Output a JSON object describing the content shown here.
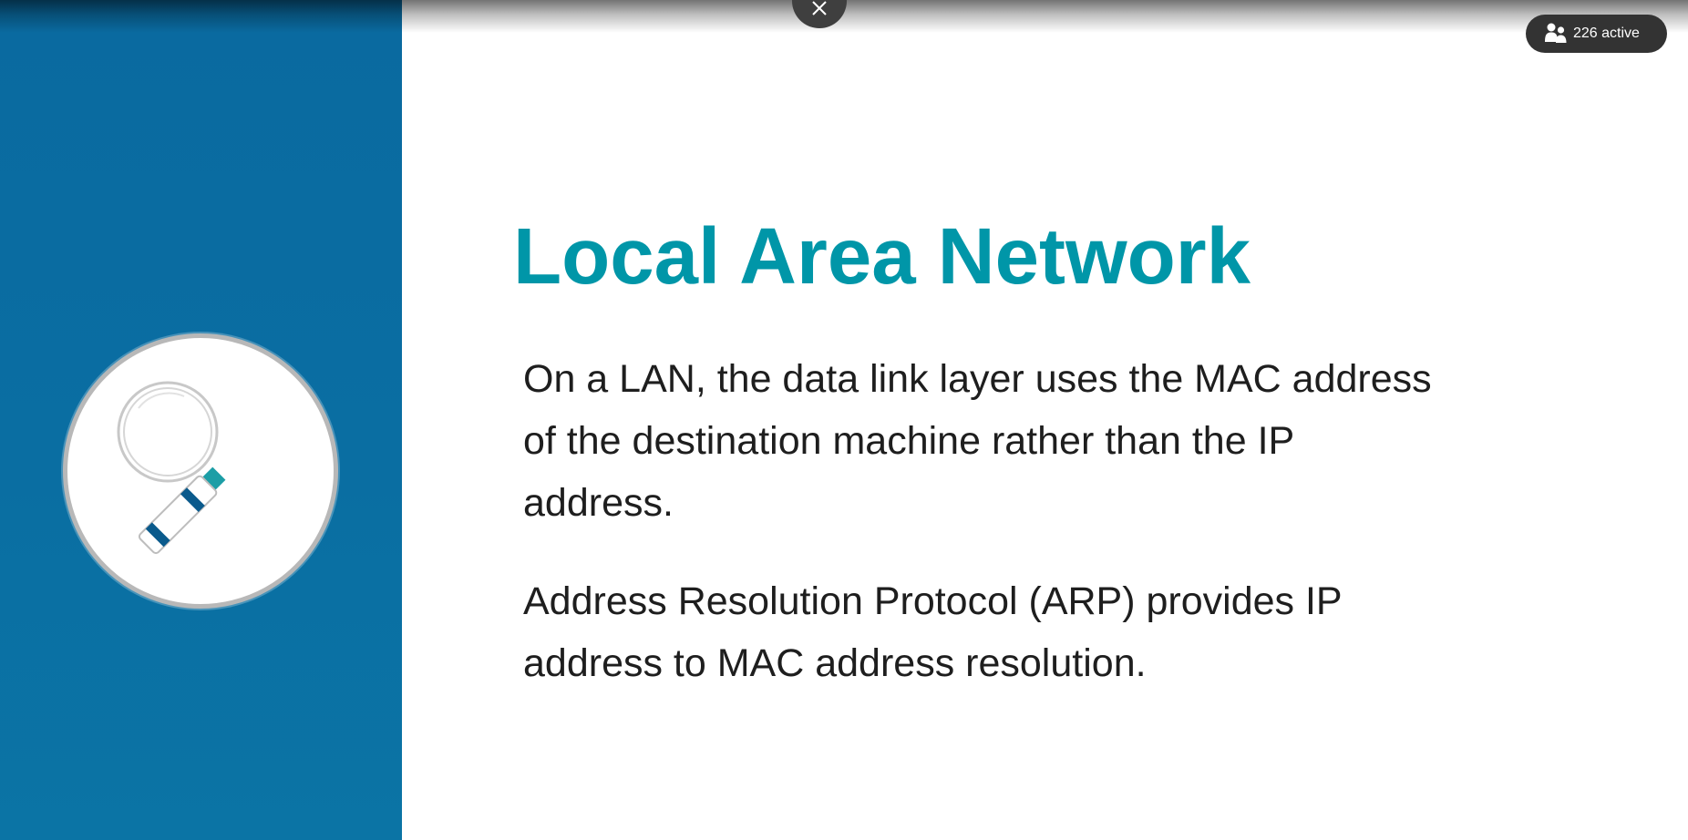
{
  "slide": {
    "title": "Local Area Network",
    "paragraphs": [
      "On a LAN, the data link layer uses the MAC address of the destination machine rather than the IP address.",
      "Address Resolution Protocol (ARP) provides IP address to MAC address resolution."
    ],
    "icon": "magnifying-glass-icon"
  },
  "viewer": {
    "active_count_label": "226 active",
    "people_icon": "people-icon",
    "close_icon": "close-icon"
  },
  "colors": {
    "sidebar": "#0a6ea2",
    "title": "#0096a8",
    "body_text": "#1e1e1e",
    "pill_bg": "#333333",
    "accent_dark": "#0a5a8c",
    "accent_teal": "#13a0a8"
  }
}
